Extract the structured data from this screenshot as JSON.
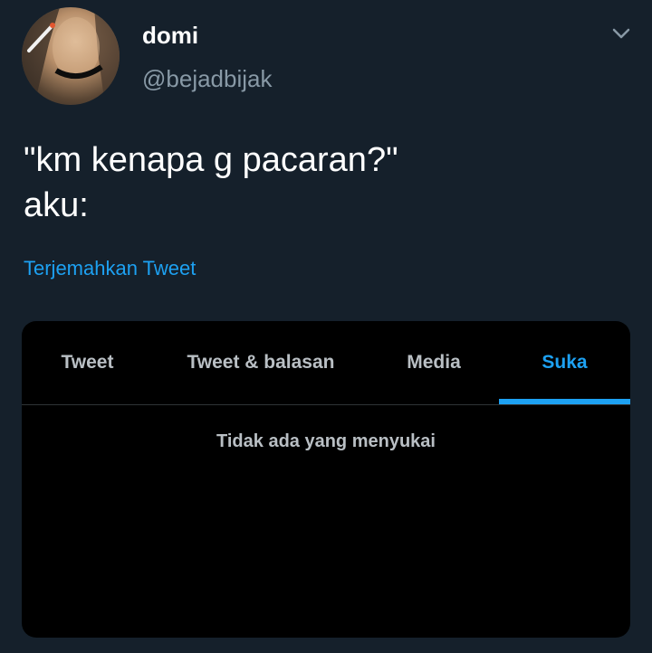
{
  "user": {
    "display_name": "domi",
    "handle": "@bejadbijak"
  },
  "tweet": {
    "lines": [
      "\"km kenapa g pacaran?\"",
      "aku:"
    ],
    "translate_label": "Terjemahkan Tweet"
  },
  "embedded_card": {
    "tabs": [
      {
        "label": "Tweet"
      },
      {
        "label": "Tweet & balasan"
      },
      {
        "label": "Media"
      },
      {
        "label": "Suka"
      }
    ],
    "active_tab": "Suka",
    "empty_message": "Tidak ada yang menyukai"
  },
  "icons": {
    "avatar": "avatar-photo",
    "menu": "chevron-down-icon"
  },
  "colors": {
    "background": "#15202b",
    "card_background": "#000000",
    "accent": "#1da1f2",
    "secondary_text": "#8899a6",
    "primary_text": "#ffffff"
  }
}
